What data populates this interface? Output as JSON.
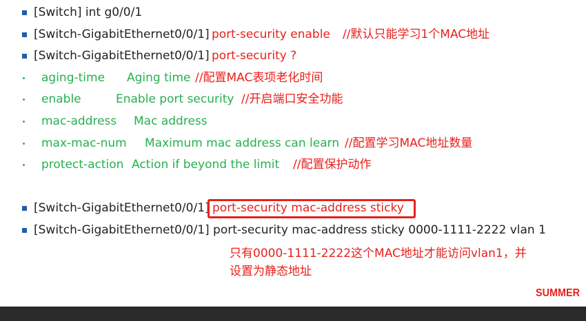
{
  "lines": [
    {
      "cmd": "[Switch] int g0/0/1"
    },
    {
      "cmd": "[Switch-GigabitEthernet0/0/1]",
      "keyword": "port-security enable",
      "comment": "//默认只能学习1个MAC地址"
    },
    {
      "cmd": "[Switch-GigabitEthernet0/0/1]",
      "keyword": "port-security ?"
    },
    {
      "option": "aging-time",
      "desc": "Aging time",
      "comment": "//配置MAC表项老化时间"
    },
    {
      "option": "enable",
      "desc": "Enable port security",
      "comment": "//开启端口安全功能"
    },
    {
      "option": "mac-address",
      "desc": "Mac address"
    },
    {
      "option": "max-mac-num",
      "desc": "Maximum mac address can learn",
      "comment": "//配置学习MAC地址数量"
    },
    {
      "option": "protect-action",
      "desc": "Action if beyond the limit",
      "comment": "//配置保护动作"
    },
    {
      "cmd": "[Switch-GigabitEthernet0/0/1]",
      "keyword": "port-security mac-address sticky"
    },
    {
      "cmd": "[Switch-GigabitEthernet0/0/1] port-security mac-address sticky 0000-1111-2222 vlan 1"
    }
  ],
  "note": {
    "line1": "只有0000-1111-2222这个MAC地址才能访问vlan1，并",
    "line2": "设置为静态地址"
  },
  "logo": "SUMMER",
  "colors": {
    "red": "#e8201b",
    "green": "#27b050",
    "bullet": "#1f5fa8",
    "text": "#222222"
  }
}
